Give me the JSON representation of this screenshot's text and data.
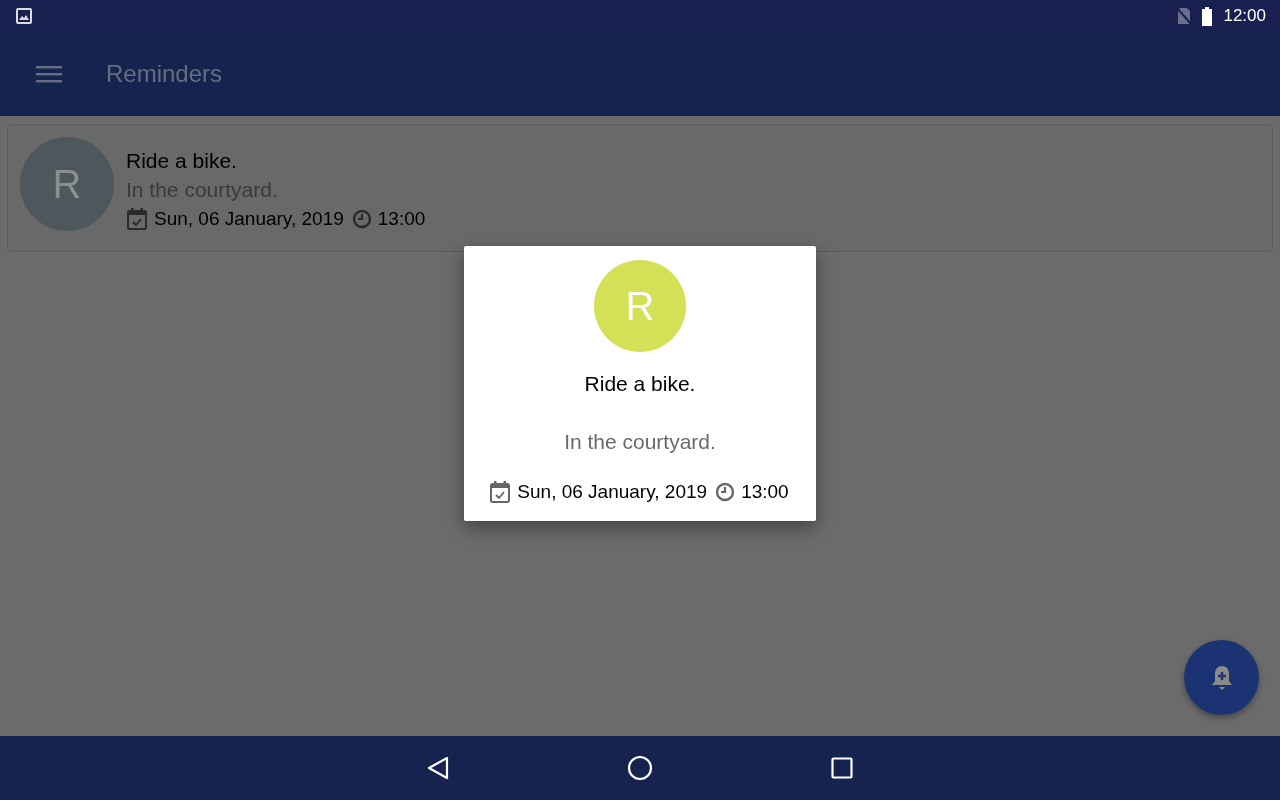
{
  "status_bar": {
    "time": "12:00"
  },
  "app_bar": {
    "title": "Reminders"
  },
  "reminders": [
    {
      "initial": "R",
      "title": "Ride a bike.",
      "note": "In the courtyard.",
      "date": "Sun, 06 January, 2019",
      "time": "13:00"
    }
  ],
  "dialog": {
    "initial": "R",
    "title": "Ride a bike.",
    "note": "In the courtyard.",
    "date": "Sun, 06 January, 2019",
    "time": "13:00"
  }
}
